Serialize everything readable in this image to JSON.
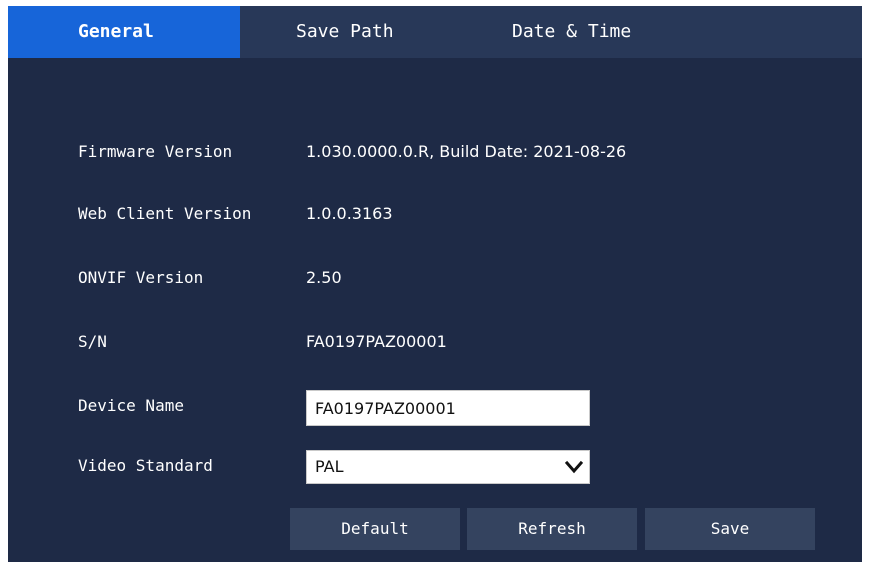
{
  "tabs": [
    {
      "label": "General",
      "active": true
    },
    {
      "label": "Save Path",
      "active": false
    },
    {
      "label": "Date & Time",
      "active": false
    }
  ],
  "info": {
    "firmware_label": "Firmware Version",
    "firmware_value": "1.030.0000.0.R, Build Date: 2021-08-26",
    "web_client_label": "Web Client Version",
    "web_client_value": "1.0.0.3163",
    "onvif_label": "ONVIF Version",
    "onvif_value": "2.50",
    "sn_label": "S/N",
    "sn_value": "FA0197PAZ00001"
  },
  "form": {
    "device_name_label": "Device Name",
    "device_name_value": "FA0197PAZ00001",
    "video_standard_label": "Video Standard",
    "video_standard_value": "PAL"
  },
  "buttons": {
    "default_label": "Default",
    "refresh_label": "Refresh",
    "save_label": "Save"
  },
  "colors": {
    "panel_bg": "#1e2a46",
    "tabbar_bg": "#283858",
    "active_tab": "#1765d9",
    "button_bg": "#34435f"
  },
  "icons": {
    "dropdown": "chevron-down-icon"
  }
}
